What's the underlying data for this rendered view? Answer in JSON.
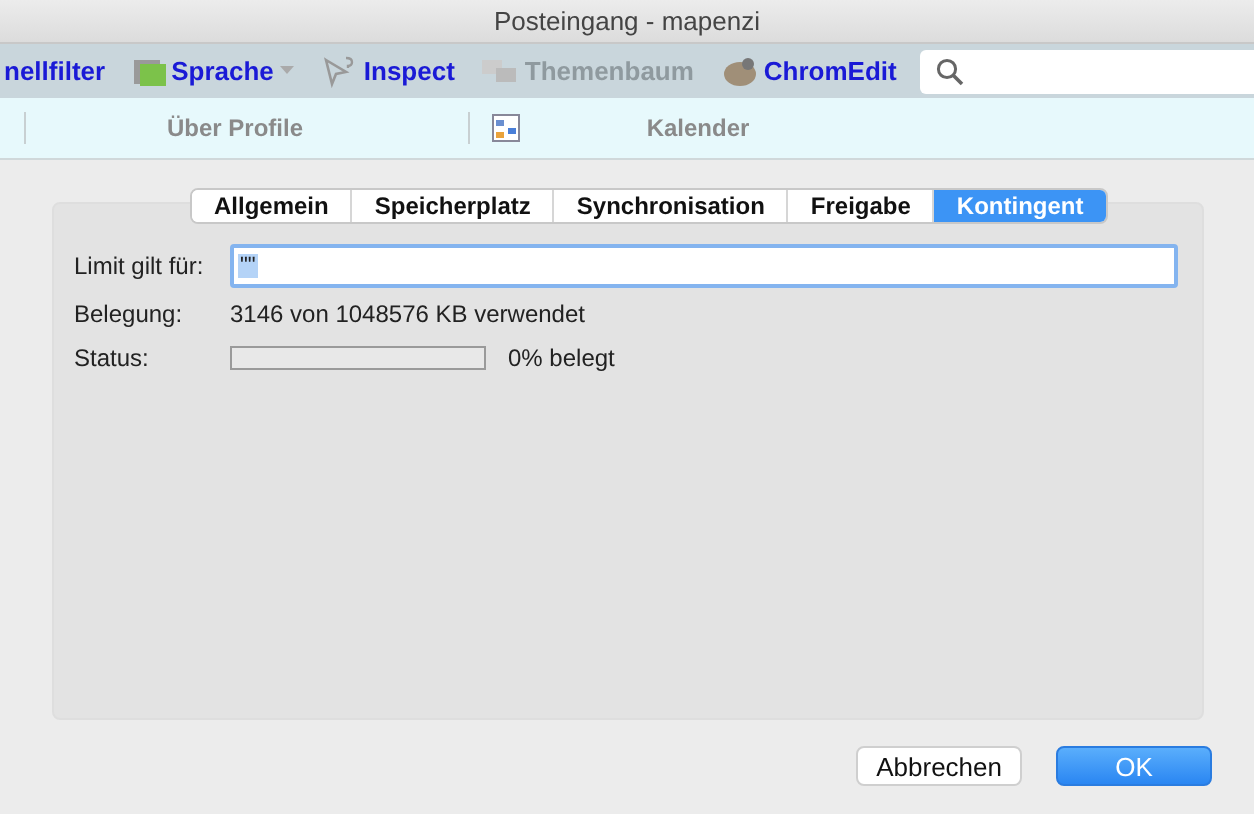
{
  "window": {
    "title": "Posteingang - mapenzi"
  },
  "toolbar": {
    "items": [
      {
        "label": "nellfilter",
        "kind": "text",
        "disabled": false
      },
      {
        "label": "Sprache",
        "kind": "dropdown",
        "disabled": false
      },
      {
        "label": "Inspect",
        "kind": "inspect",
        "disabled": false
      },
      {
        "label": "Themenbaum",
        "kind": "tree",
        "disabled": true
      },
      {
        "label": "ChromEdit",
        "kind": "edit",
        "disabled": false
      }
    ]
  },
  "tabbar": {
    "items": [
      {
        "label": "Über Profile",
        "kind": "text"
      },
      {
        "label": "Kalender",
        "kind": "calendar"
      }
    ]
  },
  "tabs": [
    {
      "label": "Allgemein",
      "selected": false
    },
    {
      "label": "Speicherplatz",
      "selected": false
    },
    {
      "label": "Synchronisation",
      "selected": false
    },
    {
      "label": "Freigabe",
      "selected": false
    },
    {
      "label": "Kontingent",
      "selected": true
    }
  ],
  "form": {
    "limit_label": "Limit gilt für:",
    "limit_value": "\"\"",
    "usage_label": "Belegung:",
    "usage_value": "3146 von 1048576 KB verwendet",
    "status_label": "Status:",
    "status": {
      "level": 0,
      "reading": "0% belegt"
    }
  },
  "buttons": [
    {
      "label": "Abbrechen",
      "kind": "secondary"
    },
    {
      "label": "OK",
      "kind": "primary"
    }
  ]
}
